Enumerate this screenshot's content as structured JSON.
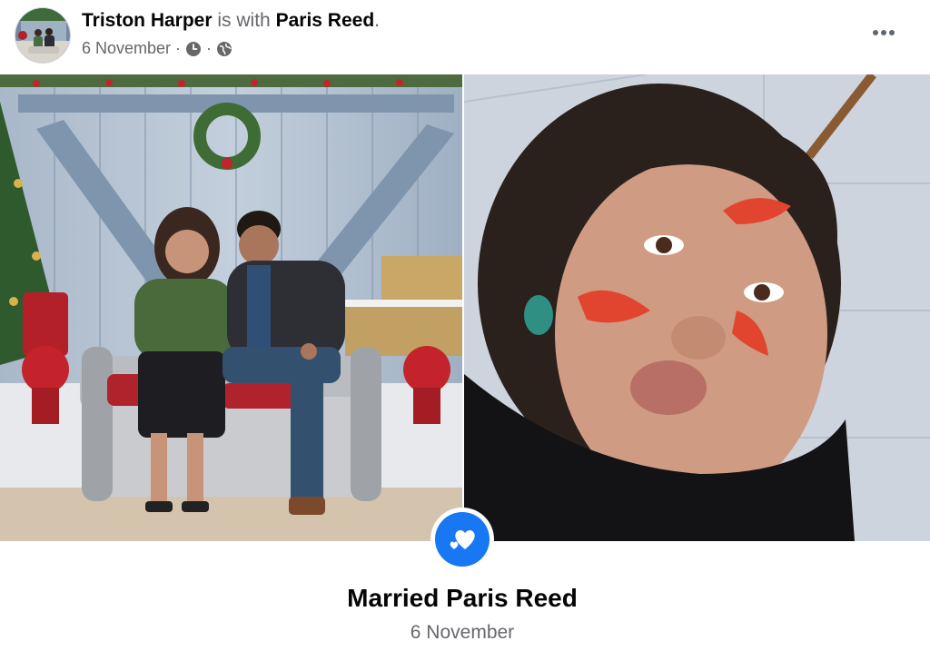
{
  "post": {
    "author": "Triston Harper",
    "with_text": "is with",
    "tagged": "Paris Reed",
    "date": "6 November"
  },
  "event": {
    "title": "Married Paris Reed",
    "date": "6 November"
  },
  "icons": {
    "privacy": "globe-icon",
    "time": "clock-icon",
    "more": "more-options-icon",
    "event": "heart-icon"
  },
  "colors": {
    "brand_blue": "#1877f2",
    "text_primary": "#050505",
    "text_secondary": "#65676b"
  }
}
